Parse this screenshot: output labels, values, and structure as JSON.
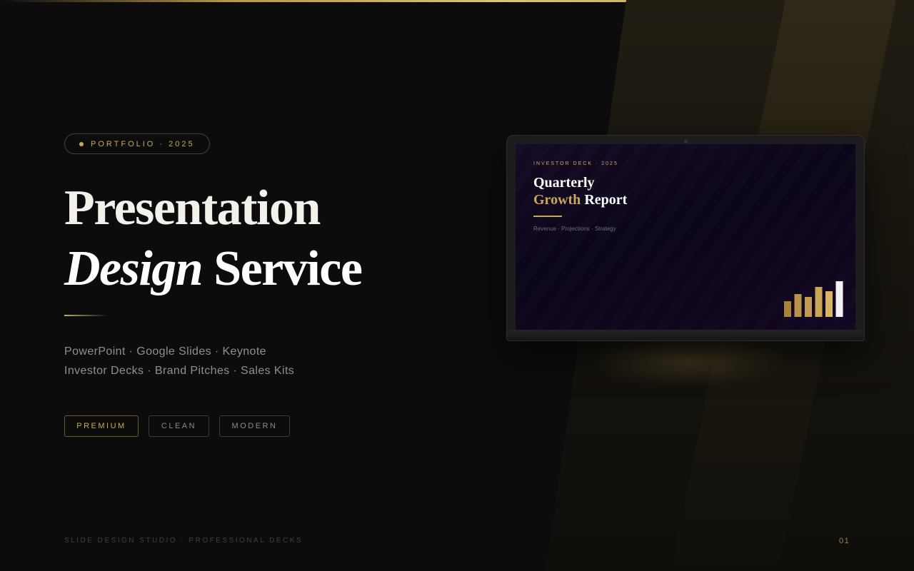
{
  "badge": {
    "label": "PORTFOLIO · 2025"
  },
  "hero": {
    "title_line1": "Presentation",
    "title_line2_italic": "Design",
    "title_line2_rest": "Service"
  },
  "subtitle": {
    "line1": "PowerPoint · Google Slides · Keynote",
    "line2": "Investor Decks · Brand Pitches · Sales Kits"
  },
  "tags": [
    {
      "label": "PREMIUM"
    },
    {
      "label": "CLEAN"
    },
    {
      "label": "MODERN"
    }
  ],
  "footer": {
    "left": "SLIDE DESIGN STUDIO · PROFESSIONAL DECKS",
    "page_number": "01"
  },
  "laptop_screen": {
    "kicker": "INVESTOR DECK · 2025",
    "title_line1": "Quarterly",
    "title_line2_accent": "Growth",
    "title_line2_rest": "Report",
    "subtitle": "Revenue · Projections · Strategy",
    "mini_chart": {
      "values": [
        22,
        32,
        28,
        42,
        36,
        50
      ],
      "colors": [
        "#a8823a",
        "#b8914a",
        "#c09a50",
        "#caa558",
        "#d8b466",
        "#f2f2f2"
      ]
    }
  },
  "colors": {
    "accent_gold": "#c9a85a",
    "background": "#0c0c0c",
    "text_primary": "#f4f1ea",
    "text_muted": "#8f8f8f"
  }
}
